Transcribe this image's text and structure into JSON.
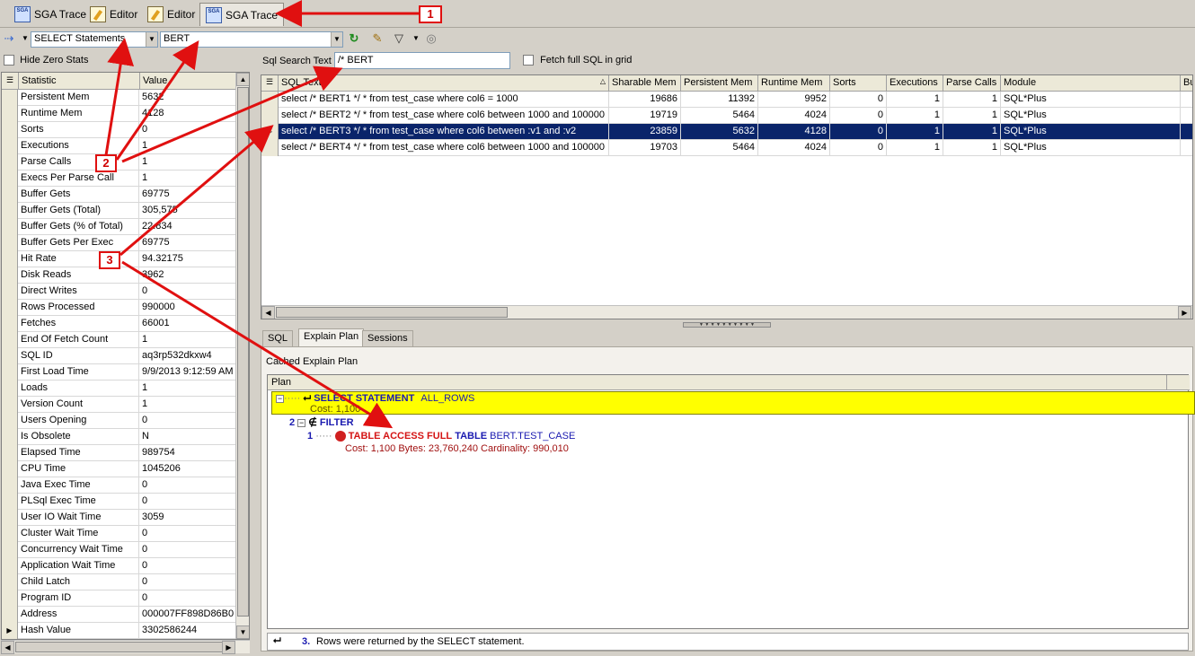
{
  "tabs": [
    {
      "label": "SGA Trace",
      "icon": "sga-icon",
      "active": false
    },
    {
      "label": "Editor",
      "icon": "editor-icon",
      "active": false
    },
    {
      "label": "Editor",
      "icon": "editor-icon",
      "active": false
    },
    {
      "label": "SGA Trace",
      "icon": "sga-icon",
      "active": true
    }
  ],
  "toolbar": {
    "statement_type": "SELECT Statements",
    "schema": "BERT"
  },
  "options": {
    "hide_zero_stats": "Hide Zero Stats",
    "sql_search_label": "Sql Search Text",
    "sql_search_value": "/* BERT",
    "fetch_full_sql": "Fetch full SQL in grid"
  },
  "stats": {
    "col_statistic": "Statistic",
    "col_value": "Value",
    "rows": [
      {
        "name": "Persistent Mem",
        "value": "5632"
      },
      {
        "name": "Runtime Mem",
        "value": "4128"
      },
      {
        "name": "Sorts",
        "value": "0"
      },
      {
        "name": "Executions",
        "value": "1"
      },
      {
        "name": "Parse Calls",
        "value": "1"
      },
      {
        "name": "Execs Per Parse Call",
        "value": "1"
      },
      {
        "name": "Buffer Gets",
        "value": "69775"
      },
      {
        "name": "Buffer Gets (Total)",
        "value": "305,575"
      },
      {
        "name": "Buffer Gets (% of Total)",
        "value": "22.834"
      },
      {
        "name": "Buffer Gets Per Exec",
        "value": "69775"
      },
      {
        "name": "Hit Rate",
        "value": "94.32175"
      },
      {
        "name": "Disk Reads",
        "value": "3962"
      },
      {
        "name": "Direct Writes",
        "value": "0"
      },
      {
        "name": "Rows Processed",
        "value": "990000"
      },
      {
        "name": "Fetches",
        "value": "66001"
      },
      {
        "name": "End Of Fetch Count",
        "value": "1"
      },
      {
        "name": "SQL ID",
        "value": "aq3rp532dkxw4"
      },
      {
        "name": "First Load Time",
        "value": "9/9/2013 9:12:59 AM"
      },
      {
        "name": "Loads",
        "value": "1"
      },
      {
        "name": "Version Count",
        "value": "1"
      },
      {
        "name": "Users Opening",
        "value": "0"
      },
      {
        "name": "Is Obsolete",
        "value": "N"
      },
      {
        "name": "Elapsed Time",
        "value": "989754"
      },
      {
        "name": "CPU Time",
        "value": "1045206"
      },
      {
        "name": "Java Exec Time",
        "value": "0"
      },
      {
        "name": "PLSql Exec Time",
        "value": "0"
      },
      {
        "name": "User IO Wait Time",
        "value": "3059"
      },
      {
        "name": "Cluster Wait Time",
        "value": "0"
      },
      {
        "name": "Concurrency Wait Time",
        "value": "0"
      },
      {
        "name": "Application Wait Time",
        "value": "0"
      },
      {
        "name": "Child Latch",
        "value": "0"
      },
      {
        "name": "Program ID",
        "value": "0"
      },
      {
        "name": "Address",
        "value": "000007FF898D86B0"
      },
      {
        "name": "Hash Value",
        "value": "3302586244"
      }
    ]
  },
  "sql_grid": {
    "columns": [
      "SQL Text",
      "Sharable Mem",
      "Persistent Mem",
      "Runtime Mem",
      "Sorts",
      "Executions",
      "Parse Calls",
      "Module",
      "Bu"
    ],
    "rows": [
      {
        "sql": "select /* BERT1 */ * from test_case where col6 = 1000",
        "sharable": "19686",
        "persistent": "11392",
        "runtime": "9952",
        "sorts": "0",
        "executions": "1",
        "parse": "1",
        "module": "SQL*Plus"
      },
      {
        "sql": "select /* BERT2 */ * from test_case where col6 between 1000 and 100000",
        "sharable": "19719",
        "persistent": "5464",
        "runtime": "4024",
        "sorts": "0",
        "executions": "1",
        "parse": "1",
        "module": "SQL*Plus"
      },
      {
        "sql": "select /* BERT3 */ * from test_case where col6 between :v1 and :v2",
        "sharable": "23859",
        "persistent": "5632",
        "runtime": "4128",
        "sorts": "0",
        "executions": "1",
        "parse": "1",
        "module": "SQL*Plus"
      },
      {
        "sql": "select /* BERT4 */ * from test_case where col6 between 1000 and 100000",
        "sharable": "19703",
        "persistent": "5464",
        "runtime": "4024",
        "sorts": "0",
        "executions": "1",
        "parse": "1",
        "module": "SQL*Plus"
      }
    ]
  },
  "bottom_tabs": [
    "SQL",
    "Explain Plan",
    "Sessions"
  ],
  "plan": {
    "title": "Cached Explain Plan",
    "col": "Plan",
    "root_op": "SELECT STATEMENT",
    "root_mode": "ALL_ROWS",
    "root_cost": "Cost: 1,100",
    "filter_num": "2",
    "filter_op": "FILTER",
    "access_num": "1",
    "access_op": "TABLE ACCESS FULL",
    "access_kw": "TABLE",
    "access_obj": "BERT.TEST_CASE",
    "access_details": "Cost: 1,100  Bytes: 23,760,240  Cardinality: 990,010",
    "status_num": "3.",
    "status_text": "Rows were returned by the SELECT statement."
  },
  "annotations": [
    "1",
    "2",
    "3"
  ],
  "colors": {
    "highlight": "#ffff00",
    "selection": "#0a246a",
    "arrow": "#e01010"
  }
}
